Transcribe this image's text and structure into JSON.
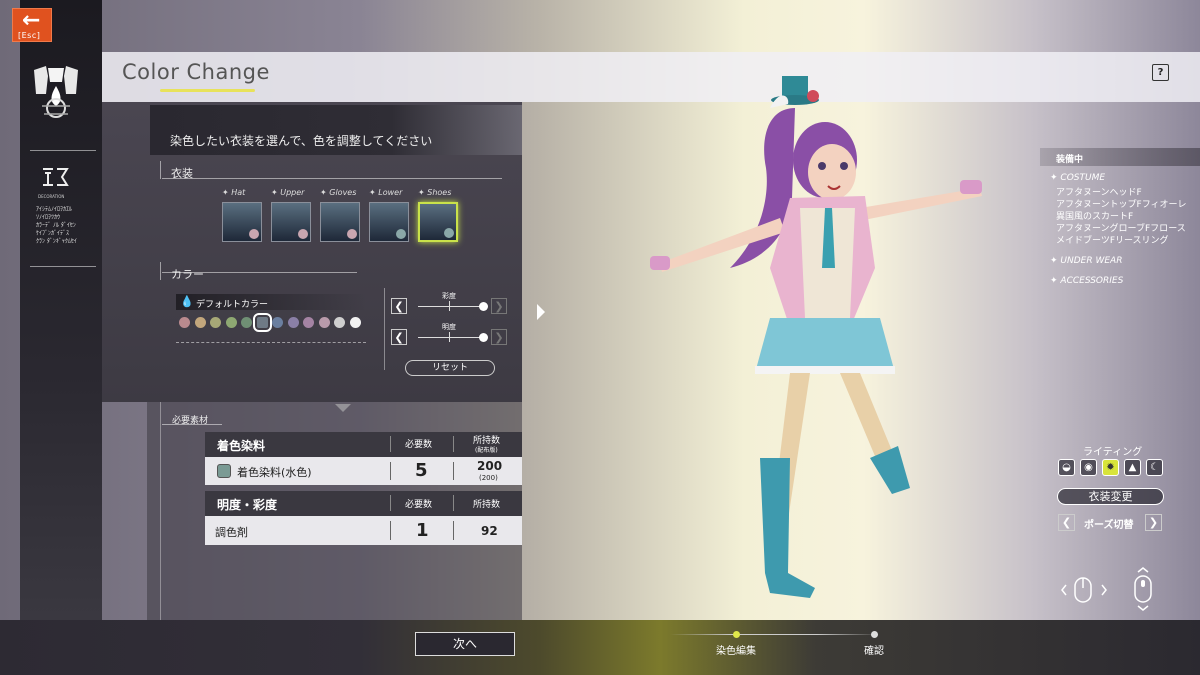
{
  "header": {
    "title": "Color Change",
    "help_icon": "?"
  },
  "esc": {
    "label": "[Esc]"
  },
  "rail": {
    "brand_lines": [
      "DECORATION",
      "SYSTEM"
    ],
    "desc_lines": [
      "ｱｲｼﾃﾑﾉｲﾛｦｶｴﾙ",
      "ｿﾉｲﾛｦﾂｶｳ",
      "ｶﾗｰﾃﾞ ﾉﾙ ﾀﾞｲｾﾝ",
      "ｹｲﾌﾞﾝｶﾞｲﾃﾞｽ",
      "ｸﾗﾝ ﾀﾞﾝｷﾞｬｸﾑｾｲ"
    ]
  },
  "panel": {
    "instruction": "染色したい衣装を選んで、色を調整してください",
    "costume_label": "衣装",
    "costume_slots": [
      {
        "label": "Hat",
        "selected": false
      },
      {
        "label": "Upper",
        "selected": false
      },
      {
        "label": "Gloves",
        "selected": false
      },
      {
        "label": "Lower",
        "selected": false
      },
      {
        "label": "Shoes",
        "selected": true
      }
    ],
    "color_label": "カラー",
    "default_color_label": "デフォルトカラー",
    "swatches": [
      "#b98a8e",
      "#c2a67c",
      "#a7a877",
      "#8ea872",
      "#6f8f74",
      "#6f7a86",
      "#6b7fa0",
      "#8a7fa6",
      "#a483a3",
      "#b99bab",
      "#cfcfcf",
      "#f2f2f2"
    ],
    "selected_swatch_index": 5,
    "saturation_label": "彩度",
    "brightness_label": "明度",
    "saturation_value": 1.0,
    "brightness_value": 1.0,
    "reset_label": "リセット"
  },
  "materials": {
    "label": "必要素材",
    "tables": [
      {
        "header": "着色染料",
        "req_label": "必要数",
        "own_label": "所持数",
        "own_sub": "(配布版)",
        "row": {
          "name": "着色染料(水色)",
          "required": "5",
          "owned": "200",
          "owned_sub": "(200)",
          "swatch": "#7a9a94"
        }
      },
      {
        "header": "明度・彩度",
        "req_label": "必要数",
        "own_label": "所持数",
        "own_sub": "",
        "row": {
          "name": "調色剤",
          "required": "1",
          "owned": "92",
          "owned_sub": "",
          "swatch": ""
        }
      }
    ]
  },
  "footer": {
    "next_label": "次へ",
    "steps": [
      "染色編集",
      "確認"
    ],
    "active_step": 0
  },
  "equipped": {
    "title": "装備中",
    "costume_header": "COSTUME",
    "costume_items": [
      "アフタヌーンヘッドF",
      "アフタヌーントップFフィオーレ",
      "異国風のスカートF",
      "アフタヌーングローブFフロース",
      "メイドブーツFリースリング"
    ],
    "underwear_header": "UNDER WEAR",
    "accessories_header": "ACCESSORIES"
  },
  "lighting": {
    "label": "ライティング",
    "modes": [
      "sunrise-icon",
      "circle-icon",
      "sun-icon",
      "landscape-icon",
      "moon-icon"
    ],
    "selected_index": 2
  },
  "controls": {
    "costume_change_label": "衣装変更",
    "pose_switch_label": "ポーズ切替"
  },
  "colors": {
    "accent": "#d8e43a",
    "esc": "#e0521f"
  }
}
